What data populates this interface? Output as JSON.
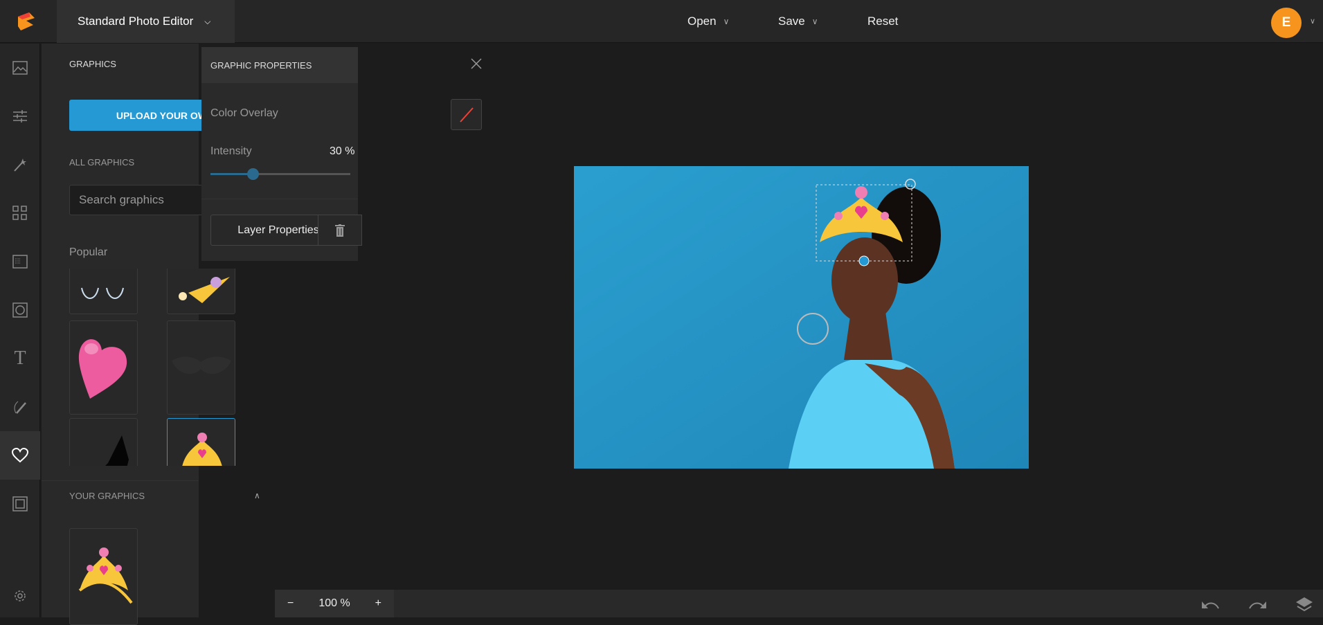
{
  "header": {
    "app_title": "Standard Photo Editor",
    "menu": [
      {
        "label": "Open"
      },
      {
        "label": "Save"
      },
      {
        "label": "Reset"
      }
    ],
    "avatar_initial": "E",
    "brand_color": "#f7941d"
  },
  "rail": {
    "items": [
      "image-icon",
      "adjust-icon",
      "magic-wand-icon",
      "grid-icon",
      "texture-icon",
      "frame-circle-icon",
      "text-icon",
      "draw-icon",
      "heart-icon",
      "border-icon",
      "gear-icon"
    ],
    "active": "heart-icon"
  },
  "panel": {
    "title": "GRAPHICS",
    "upload_label": "UPLOAD YOUR OWN",
    "all_graphics": "ALL GRAPHICS",
    "search_placeholder": "Search graphics",
    "popular": "Popular",
    "your_graphics": "YOUR GRAPHICS",
    "tiles": [
      "eyelashes",
      "tiara-partial",
      "pink-heart",
      "mustache",
      "black-shape",
      "crown"
    ],
    "accent": "#2499d3"
  },
  "props": {
    "title": "GRAPHIC PROPERTIES",
    "color_overlay": "Color Overlay",
    "intensity_label": "Intensity",
    "intensity_value": "30 %",
    "intensity": 30,
    "layer_properties": "Layer Properties"
  },
  "bottom": {
    "zoom": "100 %",
    "minus": "−",
    "plus": "+"
  }
}
